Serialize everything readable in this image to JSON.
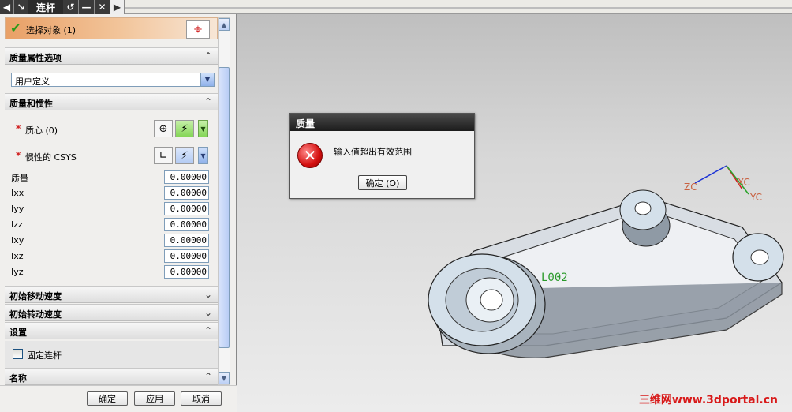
{
  "topbar": {
    "title": "连杆",
    "icons": [
      "arrow-left-icon",
      "cursor-icon",
      "reset-icon",
      "minimize-icon",
      "close-icon",
      "arrow-right-icon"
    ]
  },
  "panel": {
    "select_object": "选择对象 (1)",
    "sections": {
      "mass_props": "质量属性选项",
      "mass_inertia": "质量和惯性",
      "init_move": "初始移动速度",
      "init_rot": "初始转动速度",
      "settings": "设置",
      "name": "名称"
    },
    "dropdown_value": "用户定义",
    "cog_label": "质心 (0)",
    "csys_label": "惯性的 CSYS",
    "fields": [
      {
        "label": "质量",
        "value": "0.00000"
      },
      {
        "label": "Ixx",
        "value": "0.00000"
      },
      {
        "label": "Iyy",
        "value": "0.00000"
      },
      {
        "label": "Izz",
        "value": "0.00000"
      },
      {
        "label": "Ixy",
        "value": "0.00000"
      },
      {
        "label": "Ixz",
        "value": "0.00000"
      },
      {
        "label": "Iyz",
        "value": "0.00000"
      }
    ],
    "fixed_link": "固定连杆",
    "buttons": {
      "ok": "确定",
      "apply": "应用",
      "cancel": "取消"
    }
  },
  "dialog": {
    "title": "质量",
    "message": "输入值超出有效范围",
    "ok": "确定 (O)"
  },
  "viewport": {
    "label_l002": "L002",
    "axis_zc": "ZC",
    "axis_xc": "XC",
    "axis_yc": "YC",
    "watermark": "三维网www.3dportal.cn"
  },
  "colors": {
    "error_red": "#d40f0f",
    "select_orange": "#e9a066",
    "accent_blue": "#7f9db9"
  }
}
